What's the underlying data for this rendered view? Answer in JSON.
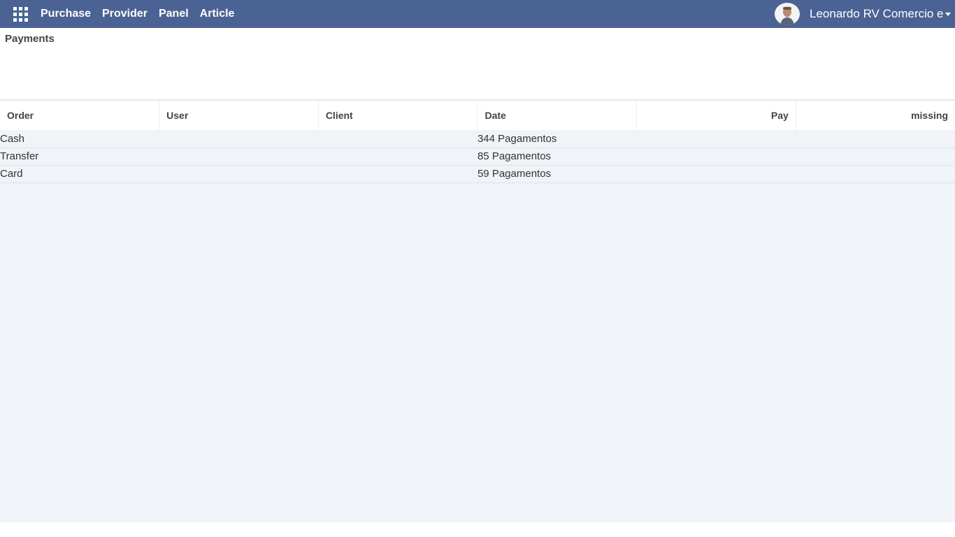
{
  "nav": {
    "menu": [
      "Purchase",
      "Provider",
      "Panel",
      "Article"
    ],
    "user_name": "Leonardo RV Comercio e se"
  },
  "page": {
    "title": "Payments"
  },
  "table": {
    "columns": [
      "Order",
      "User",
      "Client",
      "Date",
      "Pay",
      "missing"
    ],
    "groups": [
      {
        "name": "Cash",
        "count": "344 Pagamentos"
      },
      {
        "name": "Transfer",
        "count": "85 Pagamentos"
      },
      {
        "name": "Card",
        "count": "59 Pagamentos"
      }
    ]
  },
  "colors": {
    "topbar": "#4a6394",
    "content_bg": "#f0f3f8"
  }
}
